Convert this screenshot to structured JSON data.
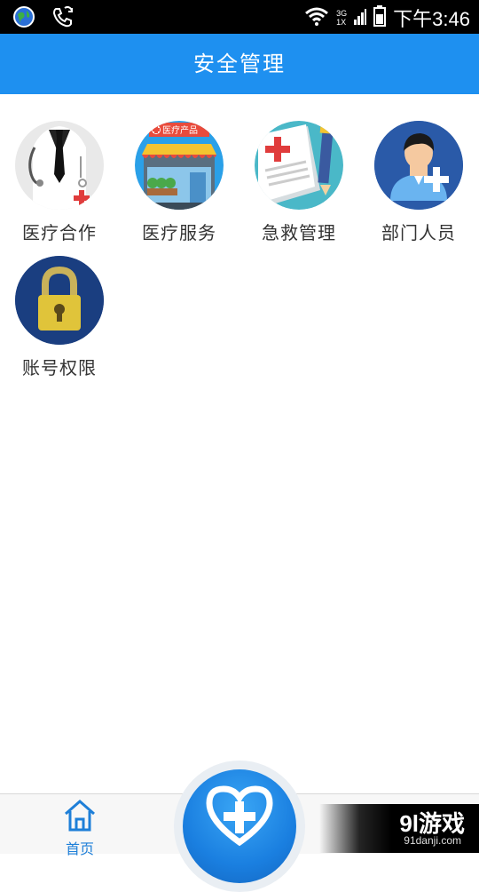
{
  "status_bar": {
    "time": "下午3:46",
    "network": [
      "3G",
      "1X"
    ]
  },
  "header": {
    "title": "安全管理"
  },
  "menu": [
    {
      "label": "医疗合作",
      "icon": "doctor-coat-icon"
    },
    {
      "label": "医疗服务",
      "icon": "medical-store-icon",
      "sign": "医疗产品"
    },
    {
      "label": "急救管理",
      "icon": "first-aid-document-icon"
    },
    {
      "label": "部门人员",
      "icon": "add-person-icon"
    },
    {
      "label": "账号权限",
      "icon": "padlock-icon"
    }
  ],
  "bottom_nav": {
    "home_label": "首页",
    "center_icon": "heart-cross-icon"
  },
  "watermark": {
    "brand": "9l游戏",
    "url": "91danji.com"
  },
  "colors": {
    "primary": "#1e90f0",
    "text": "#333333"
  }
}
